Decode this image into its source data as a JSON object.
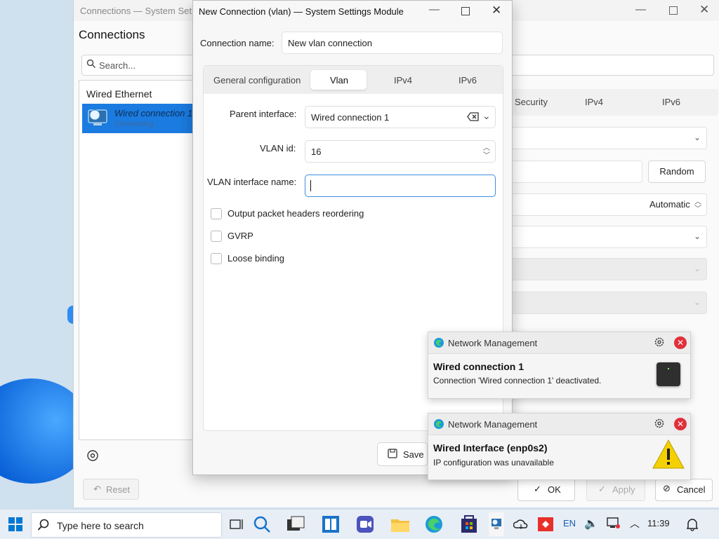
{
  "background_window": {
    "title": "Connections — System Setti",
    "heading": "Connections",
    "search_placeholder": "Search...",
    "group_label": "Wired Ethernet",
    "selected_connection": {
      "name": "Wired connection 1",
      "status": "Connecting"
    },
    "tabs": [
      "Security",
      "IPv4",
      "IPv6"
    ],
    "random_label": "Random",
    "automatic_label": "Automatic",
    "reset_label": "Reset",
    "ok_label": "OK",
    "apply_label": "Apply",
    "cancel_label": "Cancel"
  },
  "dialog": {
    "title": "New Connection (vlan) — System Settings Module",
    "connection_name_label": "Connection name:",
    "connection_name_value": "New vlan connection",
    "tabs": [
      "General configuration",
      "Vlan",
      "IPv4",
      "IPv6"
    ],
    "active_tab": "Vlan",
    "parent_interface_label": "Parent interface:",
    "parent_interface_value": "Wired connection 1",
    "vlan_id_label": "VLAN id:",
    "vlan_id_value": "16",
    "vlan_iface_label": "VLAN interface name:",
    "vlan_iface_value": "",
    "options": [
      {
        "label": "Output packet headers reordering",
        "checked": false
      },
      {
        "label": "GVRP",
        "checked": false
      },
      {
        "label": "Loose binding",
        "checked": false
      }
    ],
    "save_label": "Save"
  },
  "notifications": [
    {
      "app": "Network Management",
      "title": "Wired connection 1",
      "body": "Connection 'Wired connection 1' deactivated.",
      "icon": "network-card-icon"
    },
    {
      "app": "Network Management",
      "title": "Wired Interface (enp0s2)",
      "body": "IP configuration was unavailable",
      "icon": "warning-icon"
    }
  ],
  "taskbar": {
    "search_placeholder": "Type here to search",
    "language": "EN",
    "time": "11:39"
  },
  "colors": {
    "accent": "#1b7be0",
    "focus": "#3b8ee0",
    "close_red": "#e0303a",
    "warning_yellow": "#f5d000"
  }
}
